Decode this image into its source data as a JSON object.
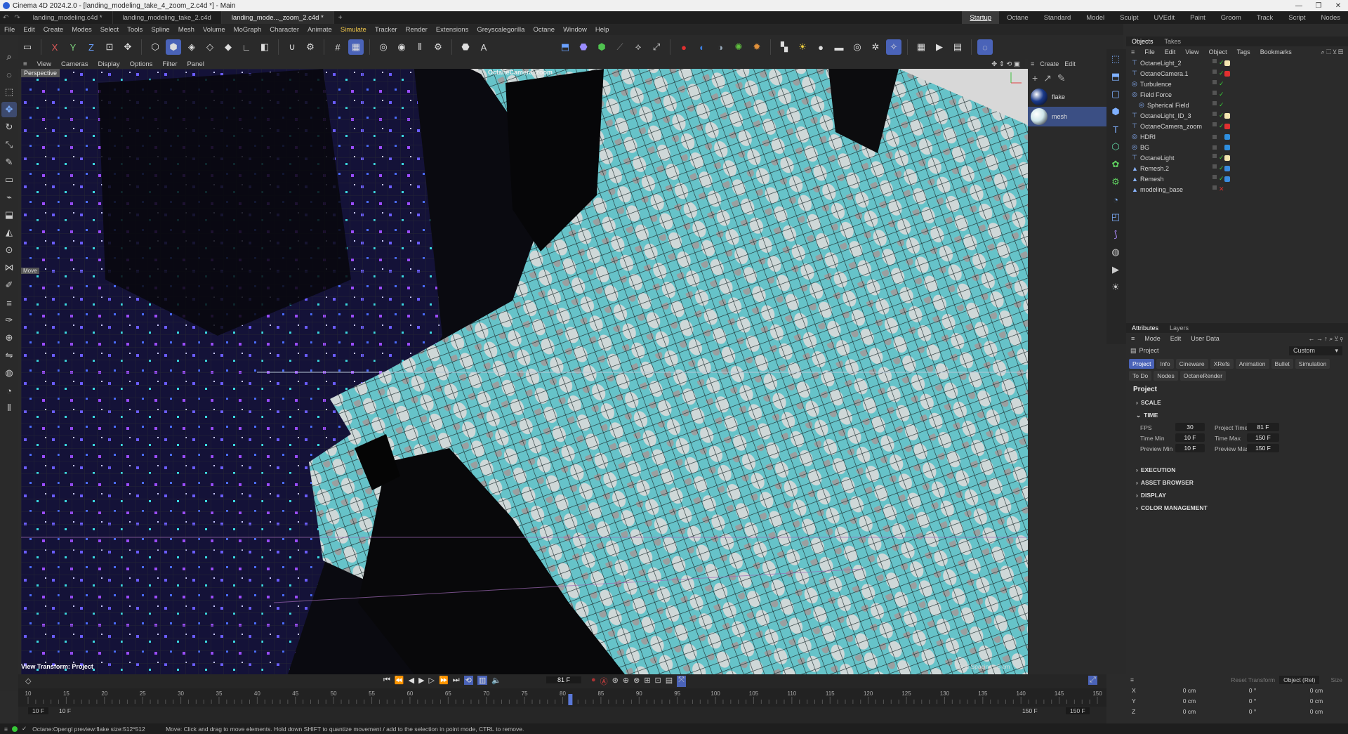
{
  "titlebar": {
    "title": "Cinema 4D 2024.2.0 - [landing_modeling_take_4_zoom_2.c4d *] - Main"
  },
  "doc_tabs": [
    {
      "label": "landing_modeling.c4d *",
      "active": false
    },
    {
      "label": "landing_modeling_take_2.c4d",
      "active": false
    },
    {
      "label": "landing_mode..._zoom_2.c4d *",
      "active": true
    }
  ],
  "layouts": [
    {
      "label": "Startup",
      "active": true
    },
    {
      "label": "Octane"
    },
    {
      "label": "Standard"
    },
    {
      "label": "Model"
    },
    {
      "label": "Sculpt"
    },
    {
      "label": "UVEdit"
    },
    {
      "label": "Paint"
    },
    {
      "label": "Groom"
    },
    {
      "label": "Track"
    },
    {
      "label": "Script"
    },
    {
      "label": "Nodes"
    }
  ],
  "menu": [
    {
      "label": "File"
    },
    {
      "label": "Edit"
    },
    {
      "label": "Create"
    },
    {
      "label": "Modes"
    },
    {
      "label": "Select"
    },
    {
      "label": "Tools"
    },
    {
      "label": "Spline"
    },
    {
      "label": "Mesh"
    },
    {
      "label": "Volume"
    },
    {
      "label": "MoGraph"
    },
    {
      "label": "Character"
    },
    {
      "label": "Animate"
    },
    {
      "label": "Simulate",
      "hl": true
    },
    {
      "label": "Tracker"
    },
    {
      "label": "Render"
    },
    {
      "label": "Extensions"
    },
    {
      "label": "Greyscalegorilla"
    },
    {
      "label": "Octane"
    },
    {
      "label": "Window"
    },
    {
      "label": "Help"
    }
  ],
  "viewport": {
    "menu": [
      "View",
      "Cameras",
      "Display",
      "Options",
      "Filter",
      "Panel"
    ],
    "label": "Perspective",
    "camera": "OctaneCamera_zoom",
    "view_transform": "View Transform: Project",
    "grid_spacing": "Grid Spacing : 5 cm",
    "move_tag": "Move"
  },
  "matpanel": {
    "menu": [
      "Create",
      "Edit"
    ],
    "materials": [
      {
        "name": "flake",
        "color": "#1a3a8a",
        "selected": false
      },
      {
        "name": "mesh",
        "color": "#cfe6ea",
        "selected": true
      }
    ]
  },
  "objects": {
    "tabs": [
      "Objects",
      "Takes"
    ],
    "menu": [
      "File",
      "Edit",
      "View",
      "Object",
      "Tags",
      "Bookmarks"
    ],
    "rows": [
      {
        "name": "OctaneLight_2",
        "indent": 0,
        "check": "#37c837",
        "tag": "#f4e6b0"
      },
      {
        "name": "OctaneCamera.1",
        "indent": 0,
        "check": "#37c837",
        "tag": "#e03030"
      },
      {
        "name": "Turbulence",
        "indent": 0,
        "check": "#37c837",
        "tag": ""
      },
      {
        "name": "Field Force",
        "indent": 0,
        "check": "#37c837",
        "tag": ""
      },
      {
        "name": "Spherical Field",
        "indent": 1,
        "check": "#37c837",
        "tag": ""
      },
      {
        "name": "OctaneLight_ID_3",
        "indent": 0,
        "check": "#37c837",
        "tag": "#f4e6b0"
      },
      {
        "name": "OctaneCamera_zoom",
        "indent": 0,
        "check": "#37c837",
        "tag": "#e03030"
      },
      {
        "name": "HDRI",
        "indent": 0,
        "check": "",
        "tag": "#2e8fe0"
      },
      {
        "name": "BG",
        "indent": 0,
        "check": "",
        "tag": "#2e8fe0"
      },
      {
        "name": "OctaneLight",
        "indent": 0,
        "check": "#37c837",
        "tag": "#f4e6b0"
      },
      {
        "name": "Remesh.2",
        "indent": 0,
        "check": "#37c837",
        "tag": "#3a8ce0"
      },
      {
        "name": "Remesh",
        "indent": 0,
        "check": "#37c837",
        "tag": "#3a8ce0"
      },
      {
        "name": "modeling_base",
        "indent": 0,
        "check": "#e03030",
        "tag": ""
      }
    ]
  },
  "attributes": {
    "tabs": [
      "Attributes",
      "Layers"
    ],
    "menu": [
      "Mode",
      "Edit",
      "User Data"
    ],
    "object": "Project",
    "preset": "Custom",
    "subtabs": [
      {
        "label": "Project",
        "active": true
      },
      {
        "label": "Info"
      },
      {
        "label": "Cineware"
      },
      {
        "label": "XRefs"
      },
      {
        "label": "Animation"
      },
      {
        "label": "Bullet"
      },
      {
        "label": "Simulation"
      },
      {
        "label": "To Do"
      },
      {
        "label": "Nodes"
      },
      {
        "label": "OctaneRender"
      }
    ],
    "heading": "Project",
    "sections": [
      "SCALE",
      "TIME",
      "EXECUTION",
      "ASSET BROWSER",
      "DISPLAY",
      "COLOR MANAGEMENT"
    ],
    "time": {
      "fps_label": "FPS",
      "fps": "30",
      "project_time_label": "Project Time",
      "project_time": "81 F",
      "time_min_label": "Time Min",
      "time_min": "10 F",
      "time_max_label": "Time Max",
      "time_max": "150 F",
      "preview_min_label": "Preview Min",
      "preview_min": "10 F",
      "preview_max_label": "Preview Max",
      "preview_max": "150 F"
    }
  },
  "coords": {
    "reset": "Reset Transform",
    "mode": "Object (Rel)",
    "size": "Size",
    "rows": [
      {
        "axis": "X",
        "pos": "0 cm",
        "rot": "0 °",
        "size": "0 cm"
      },
      {
        "axis": "Y",
        "pos": "0 cm",
        "rot": "0 °",
        "size": "0 cm"
      },
      {
        "axis": "Z",
        "pos": "0 cm",
        "rot": "0 °",
        "size": "0 cm"
      }
    ]
  },
  "timeline": {
    "current_frame": "81 F",
    "ticks": [
      "10",
      "15",
      "20",
      "25",
      "30",
      "35",
      "40",
      "45",
      "50",
      "55",
      "60",
      "65",
      "70",
      "75",
      "80",
      "85",
      "90",
      "95",
      "100",
      "105",
      "110",
      "115",
      "120",
      "125",
      "130",
      "135",
      "140",
      "145",
      "150"
    ],
    "start": "10 F",
    "preview_start": "10 F",
    "end": "150 F",
    "preview_end": "150 F",
    "playhead_frame": 81
  },
  "status": {
    "left": "Octane:Opengl preview:flake  size:512*512",
    "hint": "Move: Click and drag to move elements. Hold down SHIFT to quantize movement / add to the selection in point mode, CTRL to remove."
  }
}
